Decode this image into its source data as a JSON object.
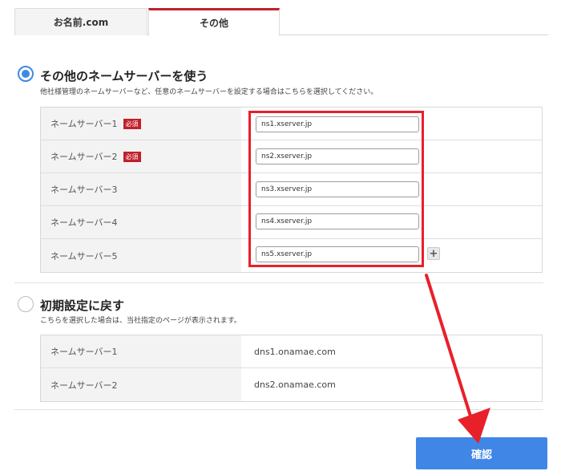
{
  "tabs": [
    {
      "label": "お名前.com"
    },
    {
      "label": "その他"
    }
  ],
  "option_other": {
    "title": "その他のネームサーバーを使う",
    "description": "他社様管理のネームサーバーなど、任意のネームサーバーを設定する場合はこちらを選択してください。",
    "required_badge": "必須",
    "rows": [
      {
        "label": "ネームサーバー1",
        "value": "ns1.xserver.jp"
      },
      {
        "label": "ネームサーバー2",
        "value": "ns2.xserver.jp"
      },
      {
        "label": "ネームサーバー3",
        "value": "ns3.xserver.jp"
      },
      {
        "label": "ネームサーバー4",
        "value": "ns4.xserver.jp"
      },
      {
        "label": "ネームサーバー5",
        "value": "ns5.xserver.jp"
      }
    ],
    "add_button": "+"
  },
  "option_default": {
    "title": "初期設定に戻す",
    "description": "こちらを選択した場合は、当社指定のページが表示されます。",
    "rows": [
      {
        "label": "ネームサーバー1",
        "value": "dns1.onamae.com"
      },
      {
        "label": "ネームサーバー2",
        "value": "dns2.onamae.com"
      }
    ]
  },
  "confirm_button": "確認",
  "colors": {
    "accent_blue": "#3f86e6",
    "required_red": "#c0202a",
    "highlight_red": "#e8202a"
  }
}
